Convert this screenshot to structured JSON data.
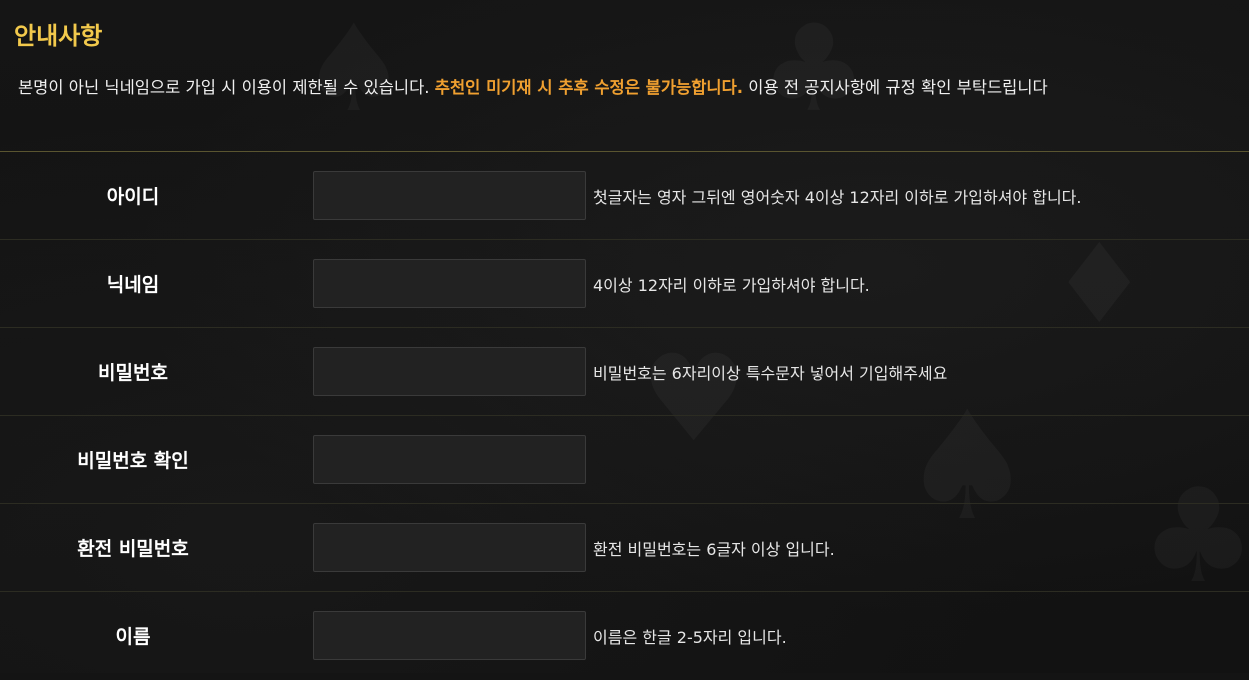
{
  "notice": {
    "title": "안내사항",
    "text_before": "본명이 아닌 닉네임으로 가입 시 이용이 제한될 수 있습니다. ",
    "text_highlight": "추천인 미기재 시 추후 수정은 불가능합니다.",
    "text_after": " 이용 전 공지사항에 규정 확인 부탁드립니다",
    "highlight_color": "#f0a030",
    "title_color": "#f2c94c"
  },
  "fields": [
    {
      "label": "아이디",
      "value": "",
      "help": "첫글자는 영자 그뒤엔 영어숫자 4이상 12자리 이하로 가입하셔야 합니다."
    },
    {
      "label": "닉네임",
      "value": "",
      "help": "4이상 12자리 이하로 가입하셔야 합니다."
    },
    {
      "label": "비밀번호",
      "value": "",
      "help": "비밀번호는 6자리이상 특수문자 넣어서 기입해주세요"
    },
    {
      "label": "비밀번호 확인",
      "value": "",
      "help": ""
    },
    {
      "label": "환전 비밀번호",
      "value": "",
      "help": "환전 비밀번호는 6글자 이상 입니다."
    },
    {
      "label": "이름",
      "value": "",
      "help": "이름은 한글 2-5자리 입니다."
    }
  ]
}
